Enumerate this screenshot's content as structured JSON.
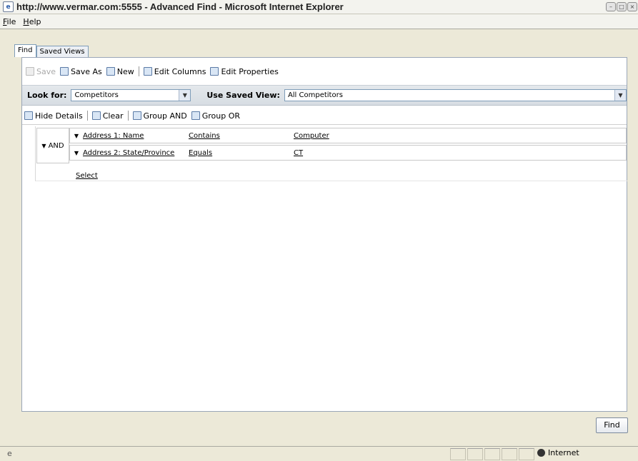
{
  "window": {
    "title": "http://www.vermar.com:5555 - Advanced Find - Microsoft Internet Explorer",
    "icon": "ie-page-icon"
  },
  "menu": [
    {
      "label": "File",
      "hotkey": "F",
      "rest": "ile"
    },
    {
      "label": "Help",
      "hotkey": "H",
      "rest": "elp"
    }
  ],
  "tabs": [
    {
      "label": "Find",
      "active": true
    },
    {
      "label": "Saved Views",
      "active": false
    }
  ],
  "toolbar": {
    "save": "Save",
    "save_as": "Save As",
    "new": "New",
    "edit_columns": "Edit Columns",
    "edit_properties": "Edit Properties"
  },
  "lookfor": {
    "label": "Look for:",
    "value": "Competitors"
  },
  "savedview": {
    "label": "Use Saved View:",
    "value": "All Competitors"
  },
  "criteria_toolbar": {
    "hide_details": "Hide Details",
    "clear": "Clear",
    "group_and": "Group AND",
    "group_or": "Group OR"
  },
  "criteria": {
    "group": "AND",
    "rows": [
      {
        "field": "Address 1: Name",
        "operator": "Contains",
        "value": "Computer"
      },
      {
        "field": "Address 2: State/Province",
        "operator": "Equals",
        "value": "CT"
      }
    ],
    "select_link": "Select"
  },
  "find_button": "Find",
  "status": {
    "zone": "Internet"
  },
  "colors": {
    "chrome": "#ece9d8",
    "lookbar": "#dbe0e6",
    "border": "#7f9db9"
  }
}
